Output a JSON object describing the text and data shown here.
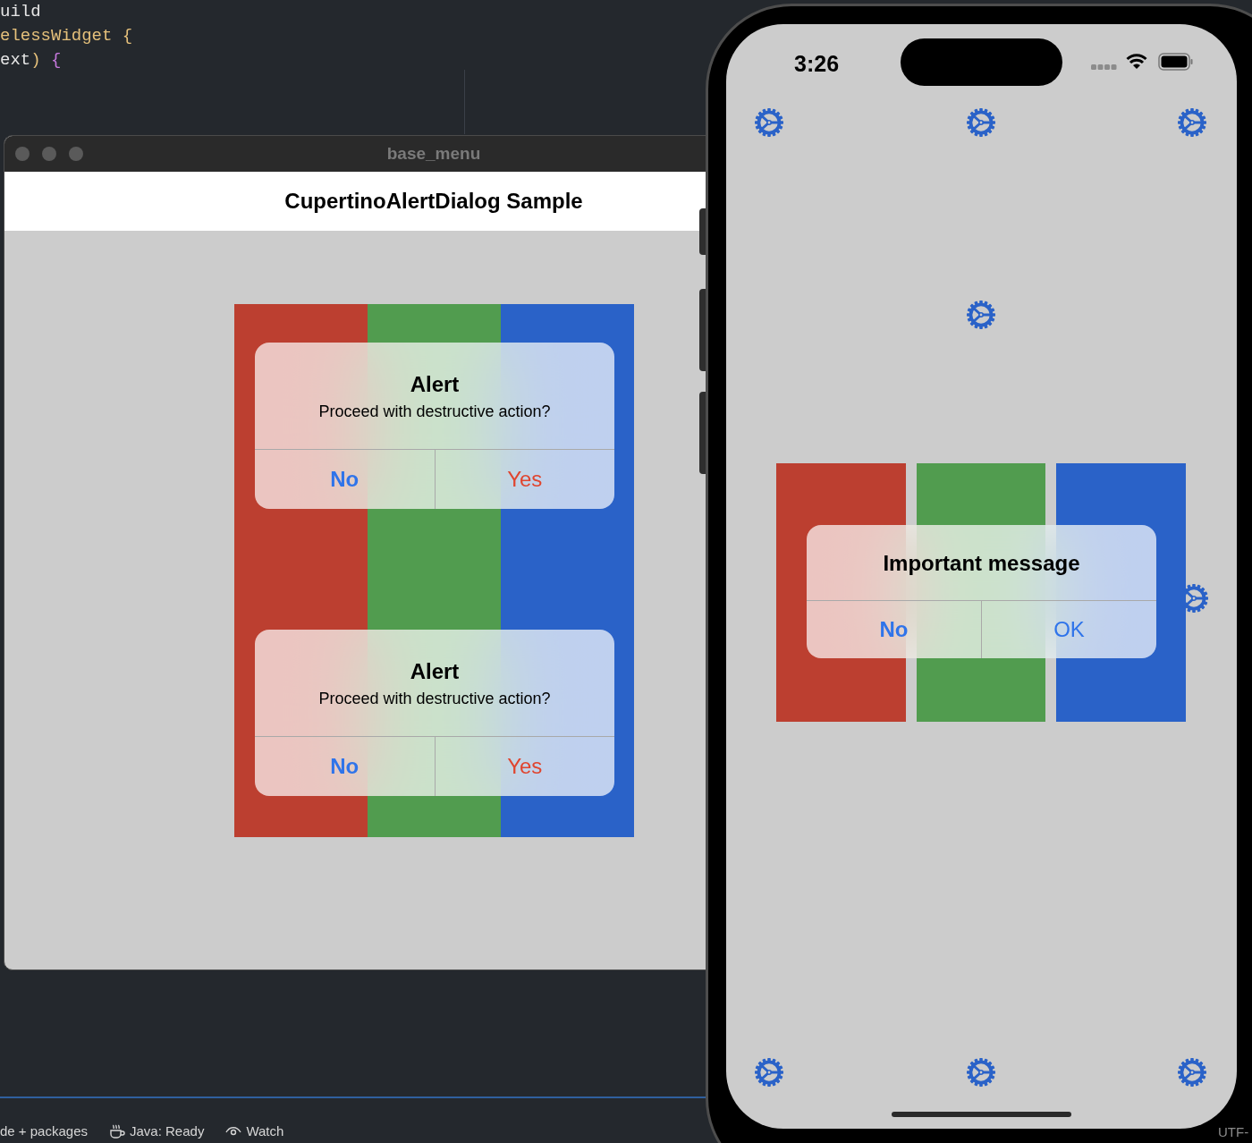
{
  "editor": {
    "code_lines": [
      [
        {
          "text": "uild",
          "color": "#e6e6e6"
        }
      ],
      [
        {
          "text": "elessWidget {",
          "color": "#e5c07b"
        }
      ],
      [
        {
          "text": "ext",
          "color": "#e6e6e6"
        },
        {
          "text": ")",
          "color": "#e5c07b"
        },
        {
          "text": " {",
          "color": "#c678dd"
        }
      ]
    ]
  },
  "window": {
    "title": "base_menu",
    "app_bar_title": "CupertinoAlertDialog Sample",
    "dialogs": [
      {
        "title": "Alert",
        "message": "Proceed with destructive action?",
        "actions": [
          {
            "label": "No",
            "is_default": true,
            "destructive": false
          },
          {
            "label": "Yes",
            "is_default": false,
            "destructive": true
          }
        ]
      },
      {
        "title": "Alert",
        "message": "Proceed with destructive action?",
        "actions": [
          {
            "label": "No",
            "is_default": true,
            "destructive": false
          },
          {
            "label": "Yes",
            "is_default": false,
            "destructive": true
          }
        ]
      }
    ]
  },
  "phone": {
    "time": "3:26",
    "dialog": {
      "title": "Important message",
      "actions": [
        {
          "label": "No",
          "is_default": true,
          "destructive": false
        },
        {
          "label": "OK",
          "is_default": false,
          "destructive": false
        }
      ]
    }
  },
  "status_bar": {
    "items": [
      {
        "label": "de + packages",
        "kind": "text"
      },
      {
        "label": "Java: Ready",
        "kind": "java"
      },
      {
        "label": "Watch",
        "kind": "watch"
      }
    ],
    "encoding": "UTF-"
  }
}
